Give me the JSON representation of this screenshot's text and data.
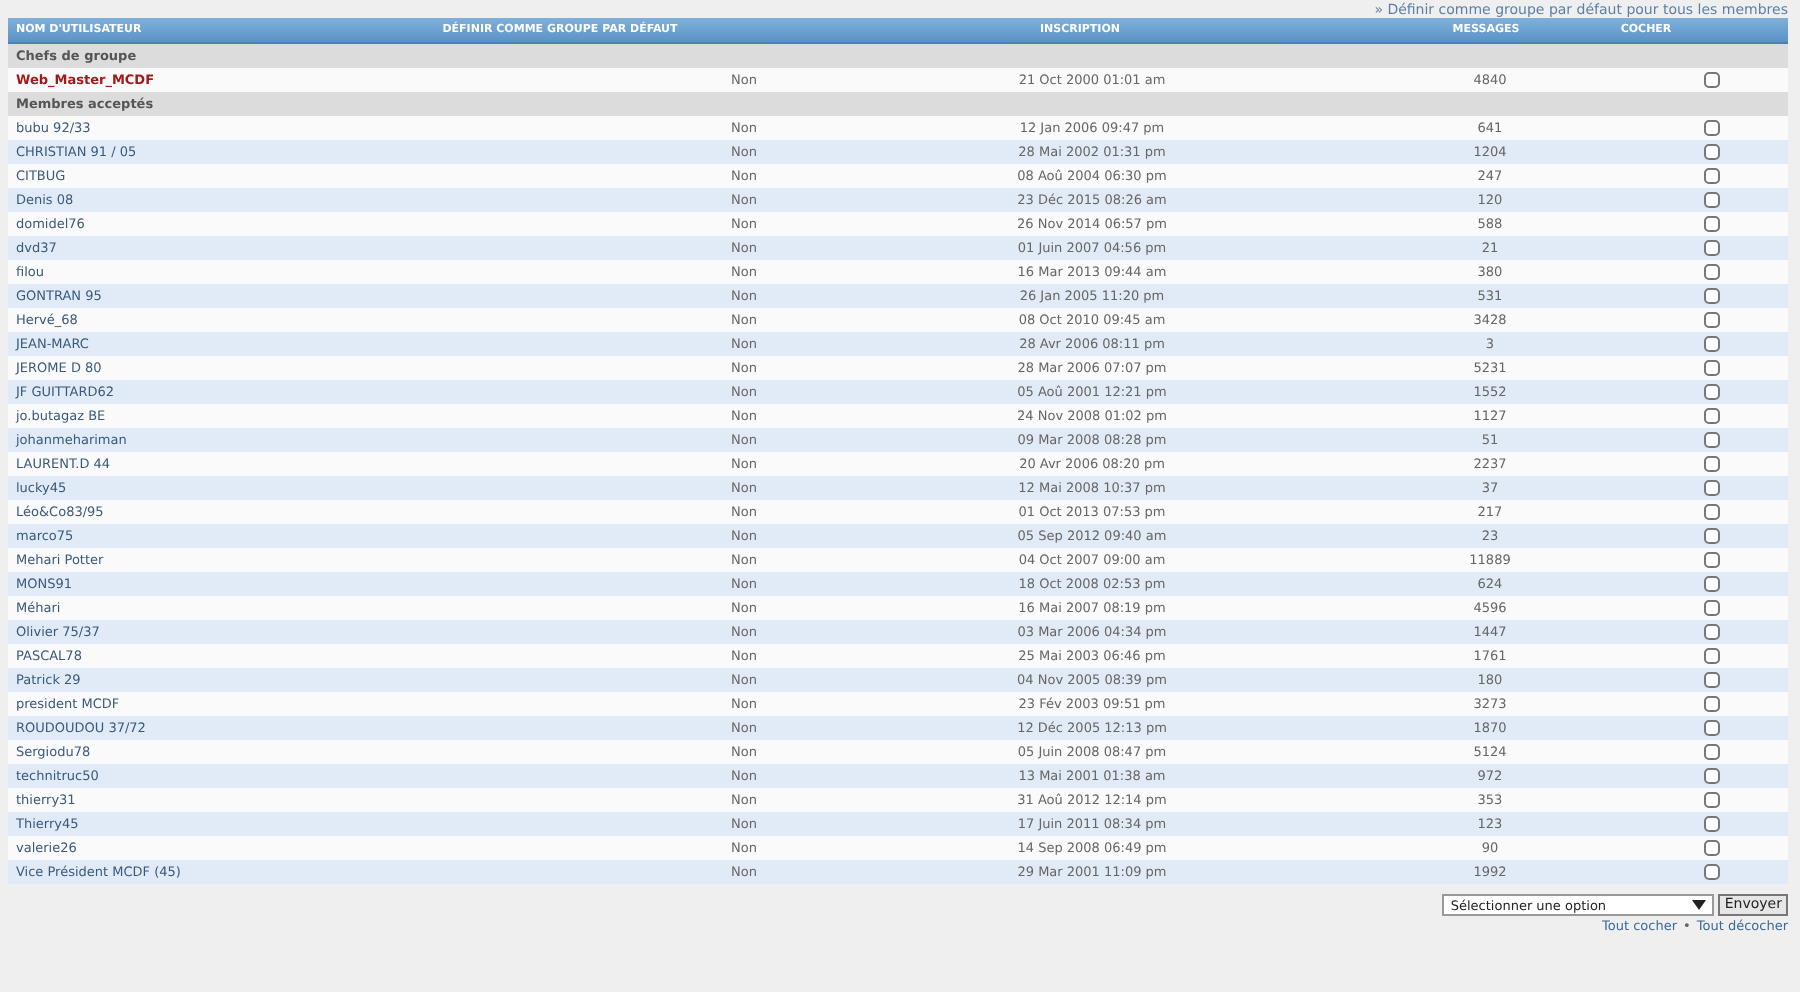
{
  "top_link": "» Définir comme groupe par défaut pour tous les membres",
  "table": {
    "columns": [
      "NOM D'UTILISATEUR",
      "DÉFINIR COMME GROUPE PAR DÉFAUT",
      "INSCRIPTION",
      "MESSAGES",
      "COCHER"
    ],
    "groups": [
      {
        "title": "Chefs de groupe",
        "kind": "leaders",
        "members": [
          {
            "name": "Web_Master_MCDF",
            "default": "Non",
            "joined": "21 Oct 2000 01:01 am",
            "messages": "4840",
            "checked": false
          }
        ]
      },
      {
        "title": "Membres acceptés",
        "kind": "members",
        "members": [
          {
            "name": "bubu 92/33",
            "default": "Non",
            "joined": "12 Jan 2006 09:47 pm",
            "messages": "641",
            "checked": false
          },
          {
            "name": "CHRISTIAN 91 / 05",
            "default": "Non",
            "joined": "28 Mai 2002 01:31 pm",
            "messages": "1204",
            "checked": false
          },
          {
            "name": "CITBUG",
            "default": "Non",
            "joined": "08 Aoû 2004 06:30 pm",
            "messages": "247",
            "checked": false
          },
          {
            "name": "Denis 08",
            "default": "Non",
            "joined": "23 Déc 2015 08:26 am",
            "messages": "120",
            "checked": false
          },
          {
            "name": "domidel76",
            "default": "Non",
            "joined": "26 Nov 2014 06:57 pm",
            "messages": "588",
            "checked": false
          },
          {
            "name": "dvd37",
            "default": "Non",
            "joined": "01 Juin 2007 04:56 pm",
            "messages": "21",
            "checked": false
          },
          {
            "name": "filou",
            "default": "Non",
            "joined": "16 Mar 2013 09:44 am",
            "messages": "380",
            "checked": false
          },
          {
            "name": "GONTRAN 95",
            "default": "Non",
            "joined": "26 Jan 2005 11:20 pm",
            "messages": "531",
            "checked": false
          },
          {
            "name": "Hervé_68",
            "default": "Non",
            "joined": "08 Oct 2010 09:45 am",
            "messages": "3428",
            "checked": false
          },
          {
            "name": "JEAN-MARC",
            "default": "Non",
            "joined": "28 Avr 2006 08:11 pm",
            "messages": "3",
            "checked": false
          },
          {
            "name": "JEROME D 80",
            "default": "Non",
            "joined": "28 Mar 2006 07:07 pm",
            "messages": "5231",
            "checked": false
          },
          {
            "name": "JF GUITTARD62",
            "default": "Non",
            "joined": "05 Aoû 2001 12:21 pm",
            "messages": "1552",
            "checked": false
          },
          {
            "name": "jo.butagaz BE",
            "default": "Non",
            "joined": "24 Nov 2008 01:02 pm",
            "messages": "1127",
            "checked": false
          },
          {
            "name": "johanmehariman",
            "default": "Non",
            "joined": "09 Mar 2008 08:28 pm",
            "messages": "51",
            "checked": false
          },
          {
            "name": "LAURENT.D 44",
            "default": "Non",
            "joined": "20 Avr 2006 08:20 pm",
            "messages": "2237",
            "checked": false
          },
          {
            "name": "lucky45",
            "default": "Non",
            "joined": "12 Mai 2008 10:37 pm",
            "messages": "37",
            "checked": false
          },
          {
            "name": "Léo&Co83/95",
            "default": "Non",
            "joined": "01 Oct 2013 07:53 pm",
            "messages": "217",
            "checked": false
          },
          {
            "name": "marco75",
            "default": "Non",
            "joined": "05 Sep 2012 09:40 am",
            "messages": "23",
            "checked": false
          },
          {
            "name": "Mehari Potter",
            "default": "Non",
            "joined": "04 Oct 2007 09:00 am",
            "messages": "11889",
            "checked": false
          },
          {
            "name": "MONS91",
            "default": "Non",
            "joined": "18 Oct 2008 02:53 pm",
            "messages": "624",
            "checked": false
          },
          {
            "name": "Méhari",
            "default": "Non",
            "joined": "16 Mai 2007 08:19 pm",
            "messages": "4596",
            "checked": false
          },
          {
            "name": "Olivier 75/37",
            "default": "Non",
            "joined": "03 Mar 2006 04:34 pm",
            "messages": "1447",
            "checked": false
          },
          {
            "name": "PASCAL78",
            "default": "Non",
            "joined": "25 Mai 2003 06:46 pm",
            "messages": "1761",
            "checked": false
          },
          {
            "name": "Patrick 29",
            "default": "Non",
            "joined": "04 Nov 2005 08:39 pm",
            "messages": "180",
            "checked": false
          },
          {
            "name": "president MCDF",
            "default": "Non",
            "joined": "23 Fév 2003 09:51 pm",
            "messages": "3273",
            "checked": false
          },
          {
            "name": "ROUDOUDOU 37/72",
            "default": "Non",
            "joined": "12 Déc 2005 12:13 pm",
            "messages": "1870",
            "checked": false
          },
          {
            "name": "Sergiodu78",
            "default": "Non",
            "joined": "05 Juin 2008 08:47 pm",
            "messages": "5124",
            "checked": false
          },
          {
            "name": "technitruc50",
            "default": "Non",
            "joined": "13 Mai 2001 01:38 am",
            "messages": "972",
            "checked": false
          },
          {
            "name": "thierry31",
            "default": "Non",
            "joined": "31 Aoû 2012 12:14 pm",
            "messages": "353",
            "checked": false
          },
          {
            "name": "Thierry45",
            "default": "Non",
            "joined": "17 Juin 2011 08:34 pm",
            "messages": "123",
            "checked": false
          },
          {
            "name": "valerie26",
            "default": "Non",
            "joined": "14 Sep 2008 06:49 pm",
            "messages": "90",
            "checked": false
          },
          {
            "name": "Vice Président MCDF (45)",
            "default": "Non",
            "joined": "29 Mar 2001 11:09 pm",
            "messages": "1992",
            "checked": false
          }
        ]
      }
    ]
  },
  "action": {
    "placeholder": "Sélectionner une option",
    "button": "Envoyer"
  },
  "links": {
    "check_all": "Tout cocher",
    "separator": "•",
    "uncheck_all": "Tout décocher"
  }
}
